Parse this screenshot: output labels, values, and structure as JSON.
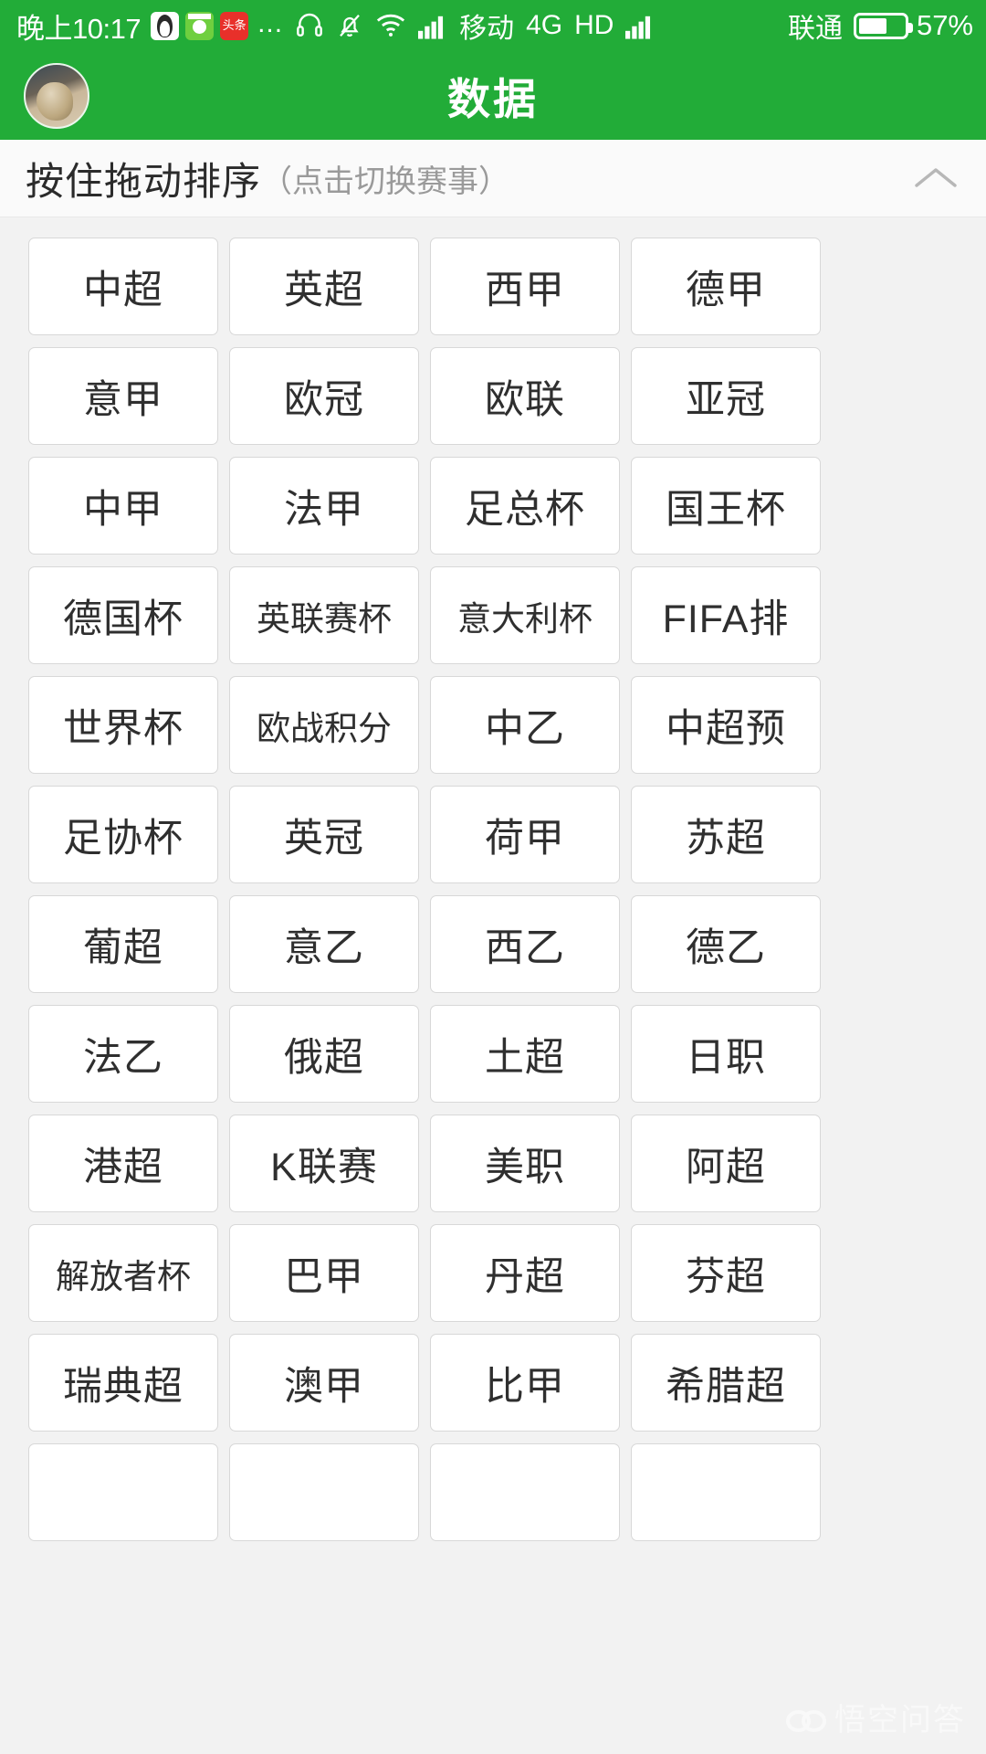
{
  "status_bar": {
    "time": "晚上10:17",
    "app_icons": [
      "qq-icon",
      "green-app-icon",
      "toutiao-icon"
    ],
    "toutiao_label": "头条",
    "overflow": "...",
    "icons": [
      "headset-icon",
      "bell-muted-icon",
      "wifi-icon",
      "signal-icon"
    ],
    "carrier_primary": "移动",
    "network_type": "4G",
    "hd_label": "HD",
    "carrier_secondary": "联通",
    "battery_percent": "57%",
    "battery_level": 57
  },
  "header": {
    "title": "数据",
    "avatar": "user-avatar",
    "background_color": "#22ac38"
  },
  "section": {
    "title": "按住拖动排序",
    "hint": "（点击切换赛事）",
    "collapse_icon": "chevron-up-icon"
  },
  "grid": {
    "columns": 4,
    "tiles": [
      {
        "label": "中超"
      },
      {
        "label": "英超"
      },
      {
        "label": "西甲"
      },
      {
        "label": "德甲"
      },
      {
        "label": "意甲"
      },
      {
        "label": "欧冠"
      },
      {
        "label": "欧联"
      },
      {
        "label": "亚冠"
      },
      {
        "label": "中甲"
      },
      {
        "label": "法甲"
      },
      {
        "label": "足总杯"
      },
      {
        "label": "国王杯"
      },
      {
        "label": "德国杯"
      },
      {
        "label": "英联赛杯",
        "small": true
      },
      {
        "label": "意大利杯",
        "small": true
      },
      {
        "label": "FIFA排"
      },
      {
        "label": "世界杯"
      },
      {
        "label": "欧战积分",
        "small": true
      },
      {
        "label": "中乙"
      },
      {
        "label": "中超预"
      },
      {
        "label": "足协杯"
      },
      {
        "label": "英冠"
      },
      {
        "label": "荷甲"
      },
      {
        "label": "苏超"
      },
      {
        "label": "葡超"
      },
      {
        "label": "意乙"
      },
      {
        "label": "西乙"
      },
      {
        "label": "德乙"
      },
      {
        "label": "法乙"
      },
      {
        "label": "俄超"
      },
      {
        "label": "土超"
      },
      {
        "label": "日职"
      },
      {
        "label": "港超"
      },
      {
        "label": "K联赛"
      },
      {
        "label": "美职"
      },
      {
        "label": "阿超"
      },
      {
        "label": "解放者杯",
        "small": true
      },
      {
        "label": "巴甲"
      },
      {
        "label": "丹超"
      },
      {
        "label": "芬超"
      },
      {
        "label": "瑞典超"
      },
      {
        "label": "澳甲"
      },
      {
        "label": "比甲"
      },
      {
        "label": "希腊超"
      },
      {
        "label": ""
      },
      {
        "label": ""
      },
      {
        "label": ""
      },
      {
        "label": ""
      }
    ]
  },
  "watermark": {
    "text": "悟空问答",
    "logo": "wukong-logo"
  },
  "colors": {
    "brand_green": "#22ac38",
    "page_background": "#f2f2f2",
    "tile_background": "#ffffff",
    "tile_border": "#d8d8d8",
    "section_background": "#fafafa"
  }
}
